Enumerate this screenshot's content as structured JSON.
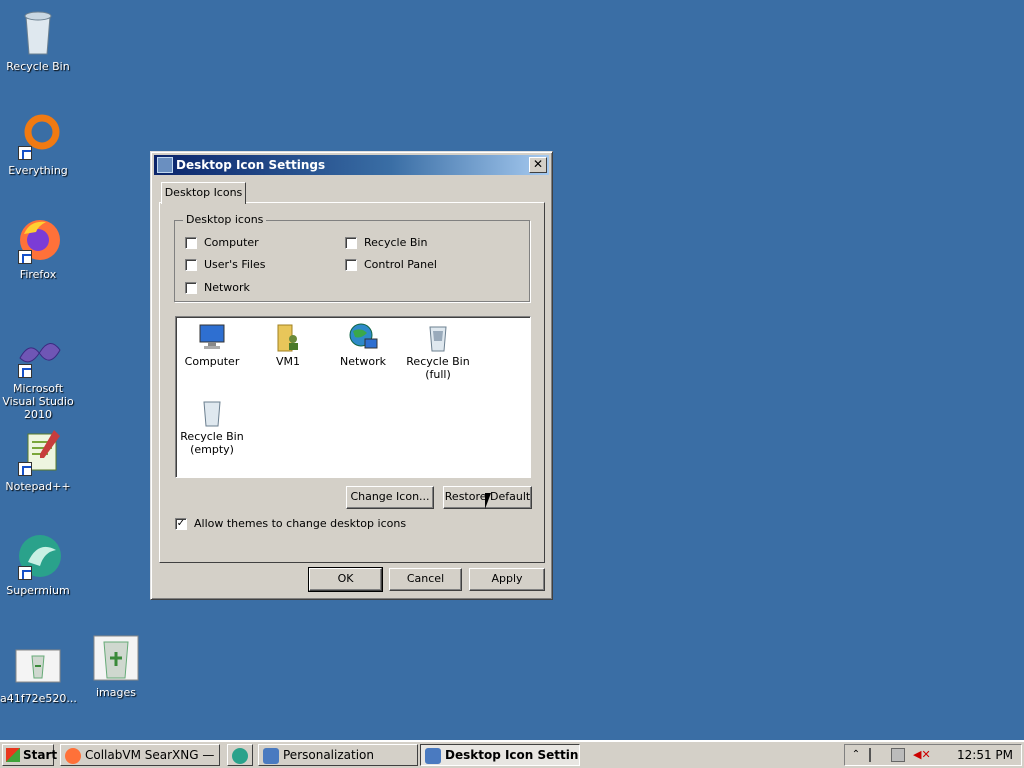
{
  "desktop": {
    "icons": [
      {
        "label": "Recycle Bin"
      },
      {
        "label": "Everything"
      },
      {
        "label": "Firefox"
      },
      {
        "label": "Microsoft Visual Studio 2010"
      },
      {
        "label": "Notepad++"
      },
      {
        "label": "Supermium"
      },
      {
        "label": "a41f72e520..."
      },
      {
        "label": "images"
      }
    ]
  },
  "dialog": {
    "title": "Desktop Icon Settings",
    "tab_label": "Desktop Icons",
    "group_label": "Desktop icons",
    "checkboxes": [
      {
        "label": "Computer",
        "checked": false
      },
      {
        "label": "Recycle Bin",
        "checked": false
      },
      {
        "label": "User's Files",
        "checked": false
      },
      {
        "label": "Control Panel",
        "checked": false
      },
      {
        "label": "Network",
        "checked": false
      }
    ],
    "icon_list": [
      {
        "label": "Computer"
      },
      {
        "label": "VM1"
      },
      {
        "label": "Network"
      },
      {
        "label": "Recycle Bin (full)"
      },
      {
        "label": "Recycle Bin (empty)"
      }
    ],
    "change_icon_label": "Change Icon...",
    "restore_default_label": "Restore Default",
    "allow_themes_label": "Allow themes to change desktop icons",
    "allow_themes_checked": true,
    "ok_label": "OK",
    "cancel_label": "Cancel",
    "apply_label": "Apply"
  },
  "taskbar": {
    "start_label": "Start",
    "tasks": [
      {
        "label": "CollabVM SearXNG — ..."
      },
      {
        "label": "Personalization"
      },
      {
        "label": "Desktop Icon Settings",
        "active": true
      }
    ],
    "clock": "12:51 PM"
  }
}
